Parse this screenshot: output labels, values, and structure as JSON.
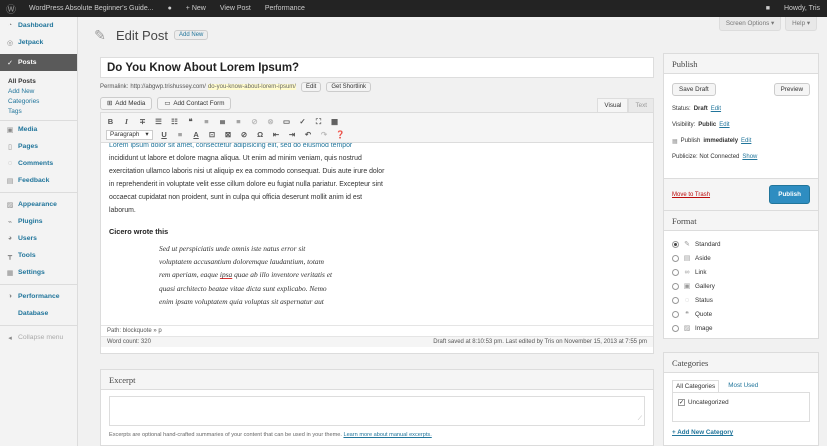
{
  "admin_bar": {
    "site_name": "WordPress Absolute Beginner's Guide...",
    "comments_icon": "speech-bubble-icon",
    "new_label": "+ New",
    "view_post": "View Post",
    "performance": "Performance",
    "howdy": "Howdy, Tris"
  },
  "sidebar": {
    "items": [
      {
        "label": "Dashboard",
        "icon": "dashboard-icon"
      },
      {
        "label": "Jetpack",
        "icon": "jetpack-icon"
      },
      {
        "label": "Posts",
        "icon": "pin-icon"
      },
      {
        "label": "Media",
        "icon": "media-icon"
      },
      {
        "label": "Pages",
        "icon": "pages-icon"
      },
      {
        "label": "Comments",
        "icon": "comments-icon"
      },
      {
        "label": "Feedback",
        "icon": "feedback-icon"
      },
      {
        "label": "Appearance",
        "icon": "appearance-icon"
      },
      {
        "label": "Plugins",
        "icon": "plugins-icon"
      },
      {
        "label": "Users",
        "icon": "users-icon"
      },
      {
        "label": "Tools",
        "icon": "tools-icon"
      },
      {
        "label": "Settings",
        "icon": "settings-icon"
      },
      {
        "label": "Performance",
        "icon": "performance-icon"
      },
      {
        "label": "Database",
        "icon": "database-icon"
      },
      {
        "label": "Collapse menu",
        "icon": "collapse-icon"
      }
    ],
    "posts_submenu": [
      "All Posts",
      "Add New",
      "Categories",
      "Tags"
    ]
  },
  "screen_options": "Screen Options ▾",
  "help": "Help ▾",
  "header": {
    "title": "Edit Post",
    "add_new": "Add New"
  },
  "post": {
    "title": "Do You Know About Lorem Ipsum?",
    "permalink_label": "Permalink:",
    "permalink_base": "http://abgwp.trishussey.com/",
    "permalink_slug": "do-you-know-about-lorem-ipsum/",
    "edit_btn": "Edit",
    "shortlink_btn": "Get Shortlink"
  },
  "editor": {
    "add_media": "Add Media",
    "add_contact_form": "Add Contact Form",
    "tab_visual": "Visual",
    "tab_text": "Text",
    "format_select": "Paragraph",
    "para_top": "Lorem ipsum dolor sit amet, consectetur adipisicing elit, sed do eiusmod tempor",
    "para_lines": [
      "incididunt ut labore et dolore magna aliqua. Ut enim ad minim veniam, quis nostrud",
      "exercitation ullamco laboris nisi ut aliquip ex ea commodo consequat. Duis aute irure dolor",
      "in reprehenderit in voluptate velit esse cillum dolore eu fugiat nulla pariatur. Excepteur sint",
      "occaecat cupidatat non proident, sunt in culpa qui officia deserunt mollit anim id est",
      "laborum."
    ],
    "heading": "Cicero wrote this",
    "quote_lines": [
      "Sed ut perspiciatis unde omnis iste natus error sit",
      "voluptatem accusantium doloremque laudantium, totam",
      "rem aperiam, eaque ",
      "quasi architecto beatae vitae dicta sunt explicabo. Nemo",
      "enim ipsam voluptatem quia voluptas sit aspernatur aut"
    ],
    "quote_misspelled": "ipsa",
    "quote_line3_rest": " quae ab illo inventore veritatis et",
    "path": "Path: blockquote » p",
    "word_count": "Word count: 320",
    "draft_saved": "Draft saved at 8:10:53 pm. Last edited by Tris on November 15, 2013 at 7:55 pm"
  },
  "excerpt": {
    "title": "Excerpt",
    "help": "Excerpts are optional hand-crafted summaries of your content that can be used in your theme.",
    "help_link": "Learn more about manual excerpts."
  },
  "publish": {
    "title": "Publish",
    "save_draft": "Save Draft",
    "preview": "Preview",
    "status_label": "Status:",
    "status_value": "Draft",
    "visibility_label": "Visibility:",
    "visibility_value": "Public",
    "publish_label": "Publish",
    "publish_value": "immediately",
    "publicize": "Publicize: Not Connected",
    "show": "Show",
    "edit": "Edit",
    "trash": "Move to Trash",
    "publish_btn": "Publish"
  },
  "format": {
    "title": "Format",
    "options": [
      {
        "label": "Standard",
        "icon": "pin-icon",
        "selected": true
      },
      {
        "label": "Aside",
        "icon": "aside-icon",
        "selected": false
      },
      {
        "label": "Link",
        "icon": "link-icon",
        "selected": false
      },
      {
        "label": "Gallery",
        "icon": "gallery-icon",
        "selected": false
      },
      {
        "label": "Status",
        "icon": "status-icon",
        "selected": false
      },
      {
        "label": "Quote",
        "icon": "quote-icon",
        "selected": false
      },
      {
        "label": "Image",
        "icon": "image-icon",
        "selected": false
      }
    ]
  },
  "categories": {
    "title": "Categories",
    "tab_all": "All Categories",
    "tab_used": "Most Used",
    "items": [
      {
        "label": "Uncategorized",
        "checked": true
      }
    ],
    "add_new": "+ Add New Category"
  },
  "colors": {
    "link": "#21759b",
    "publish": "#2e8dc1",
    "trash": "#bc0b0b",
    "admin_bar": "#232323"
  }
}
